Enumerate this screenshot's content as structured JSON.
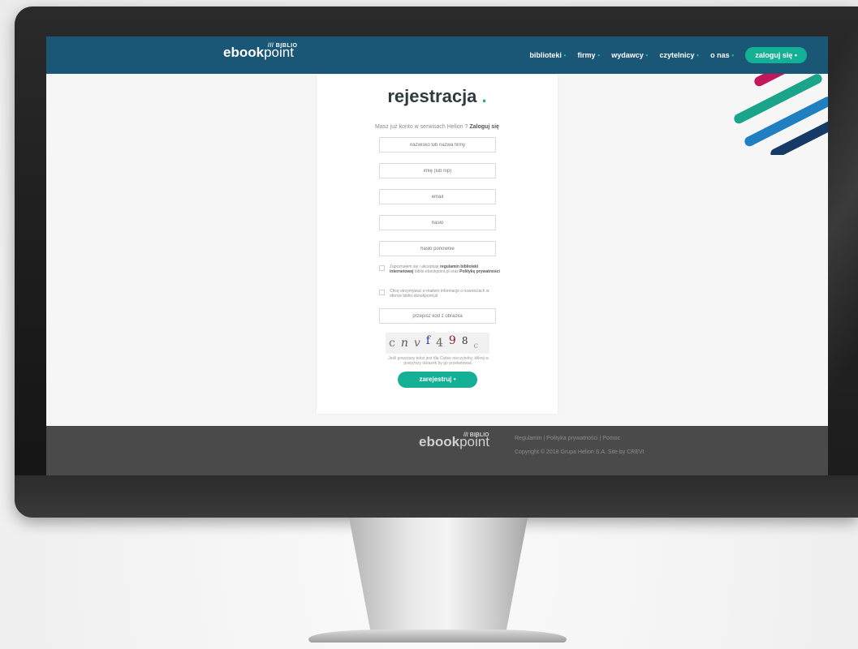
{
  "header": {
    "logo_biblio": "/// BIBLIO",
    "logo_bold": "ebook",
    "logo_light": "point",
    "nav": [
      {
        "label": "biblioteki"
      },
      {
        "label": "firmy"
      },
      {
        "label": "wydawcy"
      },
      {
        "label": "czytelnicy"
      },
      {
        "label": "o nas"
      }
    ],
    "nav_dot": "•",
    "login_label": "zaloguj się •"
  },
  "form": {
    "title": "rejestracja",
    "title_dot": ".",
    "account_text": "Masz już konto w serwisach Helion ?",
    "account_link": "Zaloguj się",
    "fields": [
      {
        "placeholder": "nazwisko lub nazwa firmy"
      },
      {
        "placeholder": "imię (lub nip)"
      },
      {
        "placeholder": "email"
      },
      {
        "placeholder": "hasło"
      },
      {
        "placeholder": "hasło ponownie"
      }
    ],
    "consent_1_pre": "Zapoznałem się i akceptuję",
    "consent_1_link1": "regulamin biblioteki internetowej",
    "consent_1_mid": "biblio.ebookpoint.pl oraz",
    "consent_1_link2": "Politykę prywatności",
    "consent_2": "Chcę otrzymywać e-mailem informacje o nowościach w ofercie biblio.ebookpoint.pl",
    "captcha_placeholder": "przepisz kod z obrazka",
    "captcha_chars": [
      "c",
      "n",
      "v",
      "f",
      "4",
      "9",
      "8",
      "c"
    ],
    "captcha_note": "Jeśli powyższy tekst jest dla Ciebie nieczytelny, kliknij w powyższy obrazek by go przeładować.",
    "submit_label": "zarejestruj •"
  },
  "footer": {
    "logo_biblio": "/// BIBLIO",
    "logo_bold": "ebook",
    "logo_light": "point",
    "links": "Regulamin | Polityka prywatności | Pomoc",
    "copyright": "Copyright © 2018 Grupa Helion S.A. Site by CREVI"
  },
  "colors": {
    "topbar": "#1a5676",
    "accent": "#14b095",
    "stripe_pink": "#c2185b",
    "stripe_teal": "#1aa58a",
    "stripe_blue": "#1f7fc0",
    "stripe_navy": "#153a66"
  }
}
